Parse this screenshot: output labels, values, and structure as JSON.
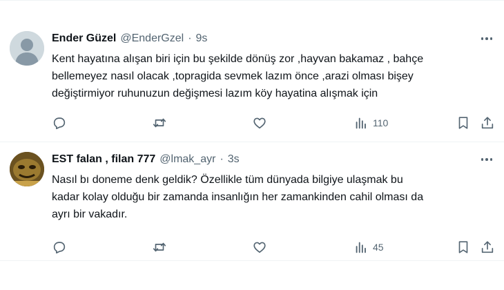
{
  "tweets": [
    {
      "name": "Ender Güzel",
      "handle": "@EnderGzel",
      "dot": "·",
      "time": "9s",
      "text": "Kent hayatına alışan biri için bu şekilde dönüş zor ,hayvan bakamaz , bahçe\nbellemeyez  nasıl olacak ,topragida sevmek lazım önce  ,arazi olması bişey\ndeğiştirmiyor ruhunuzun değişmesi lazım köy hayatina alışmak için",
      "views": "110",
      "avatar": "default-avatar"
    },
    {
      "name": "EST falan , filan 777",
      "handle": "@lmak_ayr",
      "dot": "·",
      "time": "3s",
      "text": "Nasıl bı doneme denk geldik? Özellikle tüm dünyada bilgiye ulaşmak bu\nkadar kolay olduğu bir zamanda insanlığın her zamankinden cahil olması da\nayrı bir vakadır.",
      "views": "45",
      "avatar": "photo-avatar"
    }
  ],
  "icons": [
    "reply-icon",
    "retweet-icon",
    "like-icon",
    "views-icon",
    "bookmark-icon",
    "share-icon",
    "more-icon"
  ],
  "colors": {
    "text": "#0f1419",
    "secondary": "#536471",
    "divider": "#eff3f4",
    "avatar_default": "#cfd9de"
  }
}
